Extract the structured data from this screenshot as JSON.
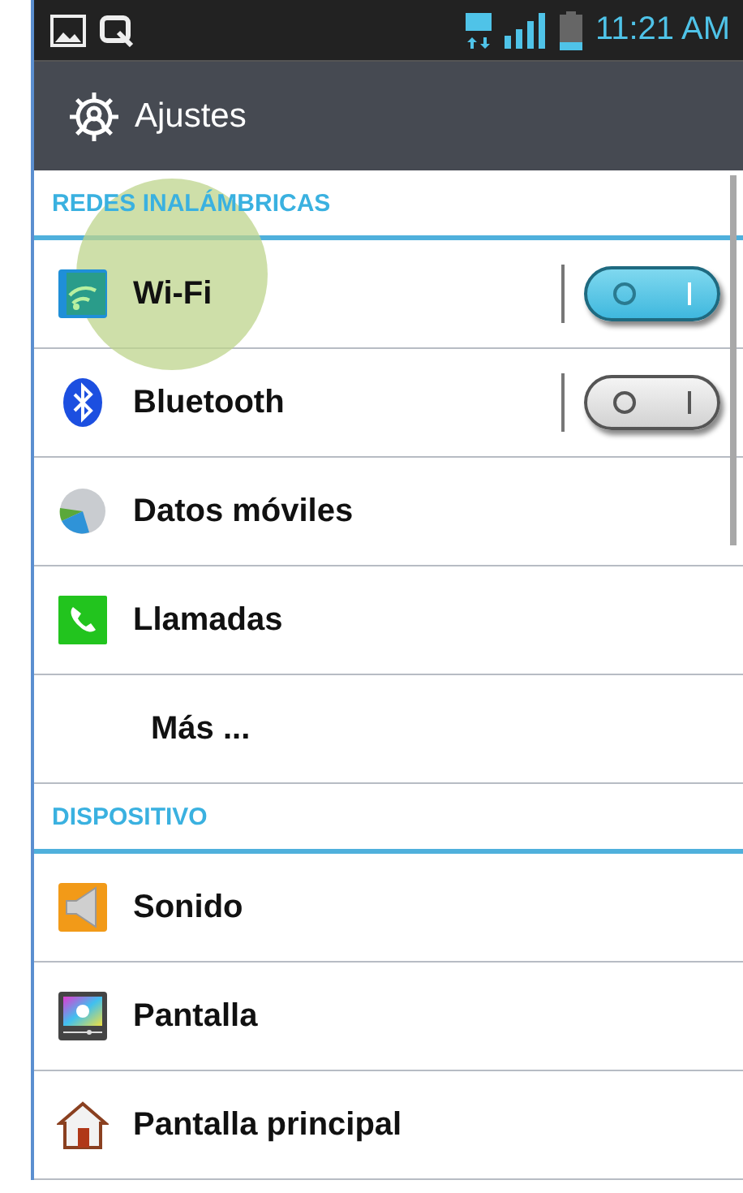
{
  "status_bar": {
    "time": "11:21 AM"
  },
  "action_bar": {
    "title": "Ajustes"
  },
  "sections": [
    {
      "header": "REDES INALÁMBRICAS",
      "items": [
        {
          "label": "Wi-Fi",
          "kind": "toggle",
          "on": true,
          "pressed": true
        },
        {
          "label": "Bluetooth",
          "kind": "toggle",
          "on": false,
          "pressed": false
        },
        {
          "label": "Datos móviles",
          "kind": "plain",
          "pressed": false
        },
        {
          "label": "Llamadas",
          "kind": "plain",
          "pressed": false
        },
        {
          "label": "Más ...",
          "kind": "plain",
          "pressed": false
        }
      ]
    },
    {
      "header": "DISPOSITIVO",
      "items": [
        {
          "label": "Sonido",
          "kind": "plain",
          "pressed": false
        },
        {
          "label": "Pantalla",
          "kind": "plain",
          "pressed": false
        },
        {
          "label": "Pantalla principal",
          "kind": "plain",
          "pressed": false
        }
      ]
    }
  ]
}
